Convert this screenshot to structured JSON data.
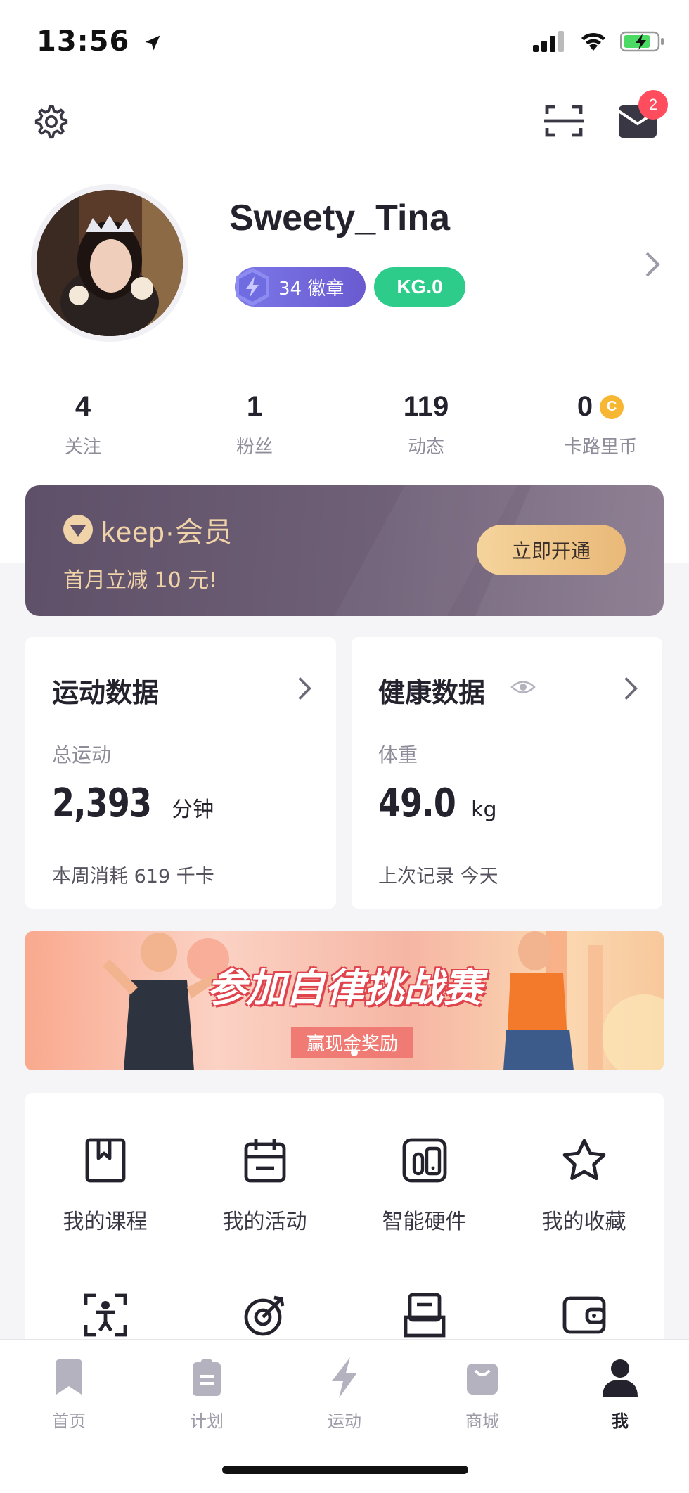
{
  "status_bar": {
    "time": "13:56"
  },
  "header": {
    "message_badge_count": "2"
  },
  "profile": {
    "username": "Sweety_Tina",
    "badge_count_label": "34 徽章",
    "level_label": "KG.0"
  },
  "stats": [
    {
      "value": "4",
      "label": "关注"
    },
    {
      "value": "1",
      "label": "粉丝"
    },
    {
      "value": "119",
      "label": "动态"
    },
    {
      "value": "0",
      "label": "卡路里币"
    }
  ],
  "vip": {
    "logo_text": "keep·会员",
    "subtitle": "首月立减 10 元!",
    "button_label": "立即开通"
  },
  "sport_card": {
    "title": "运动数据",
    "label": "总运动",
    "value": "2,393",
    "unit": "分钟",
    "footer": "本周消耗 619 千卡"
  },
  "health_card": {
    "title": "健康数据",
    "label": "体重",
    "value": "49.0",
    "unit": "kg",
    "footer": "上次记录 今天"
  },
  "banner": {
    "title": "参加自律挑战赛",
    "subtitle": "赢现金奖励"
  },
  "grid": [
    {
      "label": "我的课程",
      "icon": "bookmark-book-icon"
    },
    {
      "label": "我的活动",
      "icon": "calendar-icon"
    },
    {
      "label": "智能硬件",
      "icon": "devices-icon"
    },
    {
      "label": "我的收藏",
      "icon": "star-icon"
    }
  ],
  "grid_row2_icons": [
    "body-scan-icon",
    "target-icon",
    "inbox-icon",
    "wallet-icon"
  ],
  "tabs": [
    {
      "label": "首页",
      "icon": "bookmark-icon"
    },
    {
      "label": "计划",
      "icon": "clipboard-icon"
    },
    {
      "label": "运动",
      "icon": "lightning-icon"
    },
    {
      "label": "商城",
      "icon": "bag-icon"
    },
    {
      "label": "我",
      "icon": "person-icon",
      "active": true
    }
  ],
  "colors": {
    "accent_green": "#2ecc8b",
    "badge_purple": "#6a5ad0",
    "vip_gold": "#f0d3a8",
    "notification_red": "#ff4d5e"
  }
}
